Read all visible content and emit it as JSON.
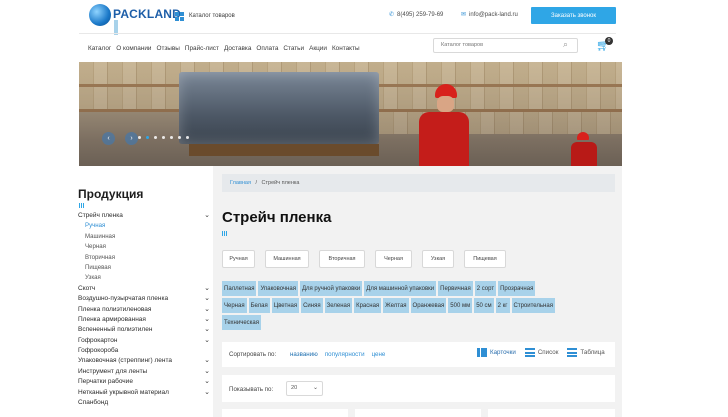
{
  "header": {
    "logo_name": "PACKLAND",
    "logo_tagline": "",
    "catalog_link": "Каталог товаров",
    "phone": "8(495) 259-79-69",
    "email": "info@pack-land.ru",
    "call_button": "Заказать звонок",
    "search_placeholder": "Каталог товаров",
    "cart_count": "0",
    "accent_color": "#2fa6e6"
  },
  "nav": {
    "items": [
      "Каталог",
      "О компании",
      "Отзывы",
      "Прайс-лист",
      "Доставка",
      "Оплата",
      "Статьи",
      "Акции",
      "Контакты"
    ]
  },
  "banner": {
    "arrow_prev": "‹",
    "arrow_next": "›",
    "slide_count": 7,
    "active_slide": 1
  },
  "sidebar": {
    "title": "Продукция",
    "categories": [
      {
        "label": "Стрейч пленка",
        "expandable": true,
        "level": 0
      },
      {
        "label": "Ручная",
        "level": 1,
        "current": true
      },
      {
        "label": "Машинная",
        "level": 1
      },
      {
        "label": "Черная",
        "level": 1
      },
      {
        "label": "Вторичная",
        "level": 1
      },
      {
        "label": "Пищевая",
        "level": 1
      },
      {
        "label": "Узкая",
        "level": 1
      },
      {
        "label": "Скотч",
        "expandable": true,
        "level": 0
      },
      {
        "label": "Воздушно-пузырчатая пленка",
        "expandable": true,
        "level": 0
      },
      {
        "label": "Пленка полиэтиленовая",
        "expandable": true,
        "level": 0
      },
      {
        "label": "Пленка армированная",
        "expandable": true,
        "level": 0
      },
      {
        "label": "Вспененный полиэтилен",
        "expandable": true,
        "level": 0
      },
      {
        "label": "Гофрокартон",
        "expandable": true,
        "level": 0
      },
      {
        "label": "Гофрокороба",
        "expandable": false,
        "level": 0
      },
      {
        "label": "Упаковочная (стреппинг) лента",
        "expandable": true,
        "level": 0
      },
      {
        "label": "Инструмент для ленты",
        "expandable": true,
        "level": 0
      },
      {
        "label": "Перчатки рабочие",
        "expandable": true,
        "level": 0
      },
      {
        "label": "Нетканый укрывной материал",
        "expandable": true,
        "level": 0
      },
      {
        "label": "Спанбонд",
        "expandable": false,
        "level": 0
      }
    ]
  },
  "breadcrumb": {
    "home": "Главная",
    "separator": "/",
    "current": "Стрейч пленка"
  },
  "page_title": "Стрейч пленка",
  "filters": {
    "buttons": [
      "Ручная",
      "Машинная",
      "Вторичная",
      "Черная",
      "Узкая",
      "Пищевая"
    ]
  },
  "tags": {
    "rows": [
      [
        "Паллетная",
        "Упаковочная",
        "Для ручной упаковки",
        "Для машинной упаковки",
        "Первичная",
        "2 сорт",
        "Прозрачная"
      ],
      [
        "Черная",
        "Белая",
        "Цветная",
        "Синяя",
        "Зеленая",
        "Красная",
        "Желтая",
        "Оранжевая",
        "500 мм",
        "50 см",
        "2 кг",
        "Строительная"
      ],
      [
        "Техническая"
      ]
    ]
  },
  "sorting": {
    "label": "Сортировать по:",
    "options": [
      {
        "label": "названию",
        "active": true
      },
      {
        "label": "популярности",
        "active": false
      },
      {
        "label": "цене",
        "active": false
      }
    ],
    "views": [
      {
        "label": "Карточки",
        "icon": "grid-view-icon",
        "active": true
      },
      {
        "label": "Список",
        "icon": "list-view-icon",
        "active": false
      },
      {
        "label": "Таблица",
        "icon": "table-view-icon",
        "active": false
      }
    ]
  },
  "show": {
    "label": "Показывать по:",
    "value": "20"
  }
}
